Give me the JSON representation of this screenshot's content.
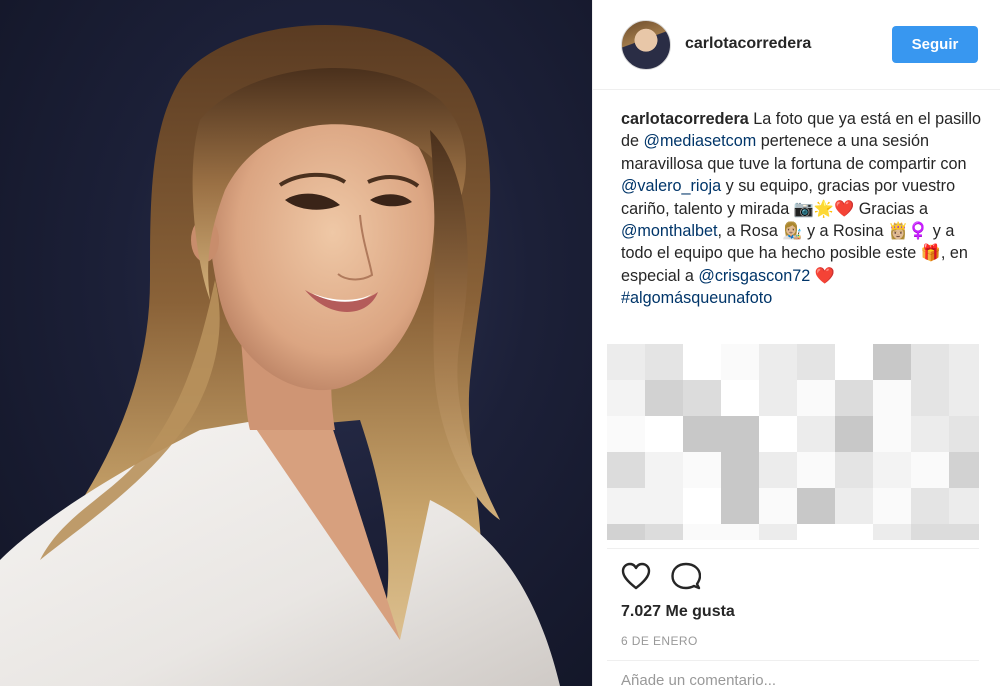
{
  "post": {
    "username": "carlotacorredera",
    "follow_label": "Seguir",
    "caption": {
      "user": "carlotacorredera",
      "t1": " La foto que ya está en el pasillo de ",
      "m1": "@mediasetcom",
      "t2": " pertenece a una sesión maravillosa que tuve la fortuna de compartir con ",
      "m2": "@valero_rioja",
      "t3": " y su equipo, gracias por vuestro cariño, talento y mirada 📷🌟❤️ Gracias a ",
      "m3": "@monthalbet",
      "t4": ", a Rosa 👩🏼‍🎨 y a Rosina 👸🏼‍♀️ y a todo el equipo que ha hecho posible este 🎁, en especial a ",
      "m4": "@crisgascon72",
      "t5": " ❤️ ",
      "tag": "#algomásqueunafoto"
    },
    "likes": "7.027 Me gusta",
    "date": "6 DE ENERO",
    "comment_placeholder": "Añade un comentario..."
  },
  "icons": {
    "like": "heart-icon",
    "comment": "comment-bubble-icon"
  },
  "colors": {
    "accent": "#3897f0",
    "link": "#003569",
    "text": "#262626",
    "muted": "#999999"
  }
}
